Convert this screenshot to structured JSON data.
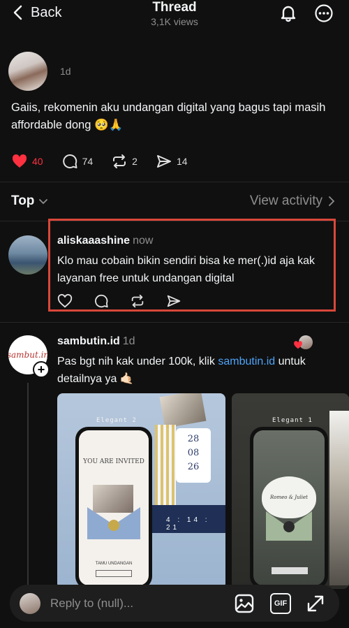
{
  "header": {
    "back_label": "Back",
    "title": "Thread",
    "views": "3,1K views"
  },
  "original_post": {
    "time": "1d",
    "text": "Gaiis, rekomenin aku undangan digital yang bagus tapi masih affordable dong 🥺🙏",
    "likes": "40",
    "comments": "74",
    "reposts": "2",
    "shares": "14",
    "liked": true
  },
  "sort": {
    "label": "Top",
    "view_activity": "View activity"
  },
  "replies": [
    {
      "username": "aliskaaashine",
      "time": "now",
      "text": "Klo mau cobain bikin sendiri bisa ke mer(.)id aja kak\nlayanan free untuk undangan digital"
    },
    {
      "username": "sambutin.id",
      "time": "1d",
      "text_before": "Pas bgt nih kak under 100k, klik ",
      "link": "sambutin.id",
      "text_after": " untuk detailnya ya 🤙🏻",
      "avatar_logo": "sambut.in",
      "images": [
        {
          "label": "Elegant 2",
          "invite_text": "YOU ARE INVITED",
          "tamu": "TAMU UNDANGAN",
          "cal_day": "28",
          "cal_month": "08",
          "cal_year": "26",
          "countdown": "4 : 14 : 21"
        },
        {
          "label": "Elegant 1",
          "names": "Romeo & Juliet"
        }
      ]
    }
  ],
  "reply_bar": {
    "placeholder": "Reply to (null)...",
    "gif_label": "GIF"
  },
  "colors": {
    "background": "#101010",
    "heart": "#ff3040",
    "link": "#4ea3f7",
    "highlight": "#d9473a",
    "muted": "#8e8e8e"
  },
  "icons": [
    "chevron-left-icon",
    "bell-icon",
    "more-icon",
    "heart-icon",
    "comment-icon",
    "repost-icon",
    "share-icon",
    "chevron-down-icon",
    "chevron-right-icon",
    "image-icon",
    "gif-icon",
    "expand-icon"
  ]
}
